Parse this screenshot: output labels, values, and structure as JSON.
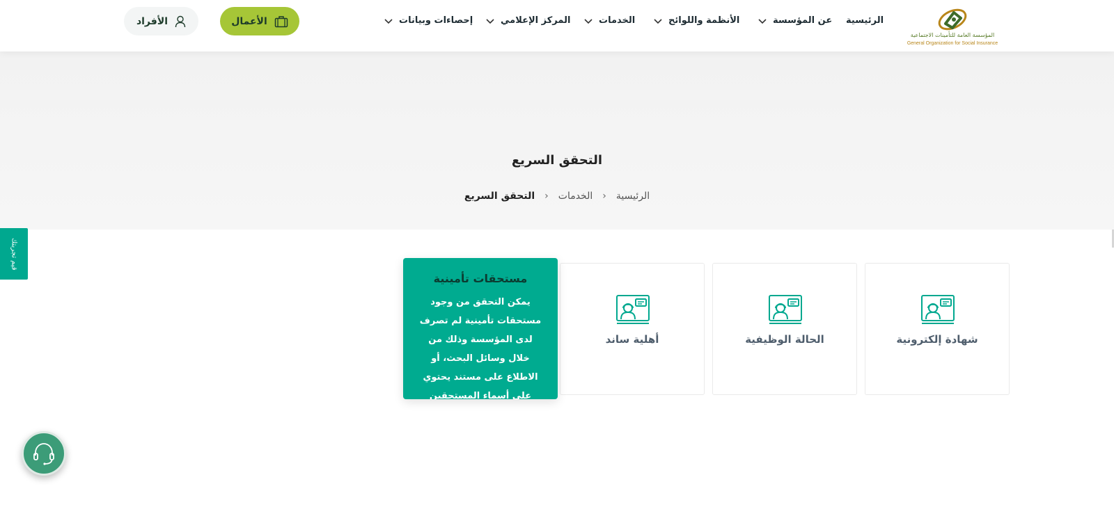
{
  "header": {
    "logo": {
      "arabic": "المؤسسة العامة للتأمينات الاجتماعية",
      "english": "General Organization for Social Insurance",
      "icon": "gosi-logo-icon"
    },
    "nav": [
      {
        "label": "الرئيسية",
        "has_dropdown": false
      },
      {
        "label": "عن المؤسسة",
        "has_dropdown": true
      },
      {
        "label": "الأنظمة واللوائح",
        "has_dropdown": true
      },
      {
        "label": "الخدمات",
        "has_dropdown": true
      },
      {
        "label": "المركز الإعلامي",
        "has_dropdown": true
      },
      {
        "label": "إحصاءات وبيانات",
        "has_dropdown": true
      }
    ],
    "business_button": {
      "label": "الأعمال",
      "icon": "briefcase-icon",
      "color": "#a6c637"
    },
    "individuals_button": {
      "label": "الأفراد",
      "icon": "user-icon"
    }
  },
  "hero": {
    "title": "التحقق السريع",
    "breadcrumb": [
      {
        "label": "الرئيسية"
      },
      {
        "label": "الخدمات"
      },
      {
        "label": "التحقق السريع",
        "current": true
      }
    ]
  },
  "side_tab": {
    "label": "قيم تجربتك"
  },
  "cards": [
    {
      "label": "شهادة إلكترونية",
      "icon": "agent-monitor-icon"
    },
    {
      "label": "الحالة الوظيفية",
      "icon": "agent-monitor-icon"
    },
    {
      "label": "أهلية ساند",
      "icon": "agent-monitor-icon"
    }
  ],
  "active_card": {
    "title": "مستحقات تأمينية",
    "description": "يمكن التحقق من وجود مستحقات تأمينية لم تصرف لدى المؤسسة وذلك من خلال وسائل البحث، أو الاطلاع على مستند يحتوي على أسماء المستحقين",
    "color": "#00ab90"
  },
  "support_button": {
    "icon": "headset-icon",
    "color": "#3c9c78"
  }
}
